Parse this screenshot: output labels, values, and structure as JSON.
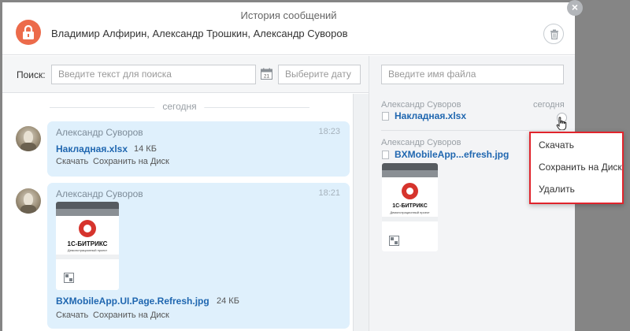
{
  "header": {
    "title": "История сообщений",
    "participants": "Владимир Алфирин, Александр Трошкин, Александр Суворов"
  },
  "search": {
    "label": "Поиск:",
    "placeholder": "Введите текст для поиска",
    "date_placeholder": "Выберите дату",
    "calendar_day": "21",
    "file_placeholder": "Введите имя файла"
  },
  "history": {
    "day_separator": "сегодня",
    "messages": [
      {
        "author": "Александр Суворов",
        "time": "18:23",
        "file_name": "Накладная.xlsx",
        "file_size": "14 КБ",
        "download": "Скачать",
        "save_to_disk": "Сохранить на Диск"
      },
      {
        "author": "Александр Суворов",
        "time": "18:21",
        "file_name": "BXMobileApp.UI.Page.Refresh.jpg",
        "file_size": "24 КБ",
        "download": "Скачать",
        "save_to_disk": "Сохранить на Диск",
        "thumb_brand": "1С-БИТРИКС",
        "thumb_subtitle": "Демонстрационный проект"
      }
    ]
  },
  "files_panel": {
    "items": [
      {
        "author": "Александр Суворов",
        "date": "сегодня",
        "file_name": "Накладная.xlsx"
      },
      {
        "author": "Александр Суворов",
        "file_name": "BXMobileApp...efresh.jpg",
        "thumb_brand": "1С-БИТРИКС",
        "thumb_subtitle": "Демонстрационный проект"
      }
    ]
  },
  "context_menu": {
    "items": [
      "Скачать",
      "Сохранить на Диск",
      "Удалить"
    ]
  },
  "colors": {
    "accent": "#ec6b4b",
    "link": "#2067b0",
    "bubble": "#dff0fc",
    "overlay": "#858585",
    "menu_border": "#e0242c"
  }
}
